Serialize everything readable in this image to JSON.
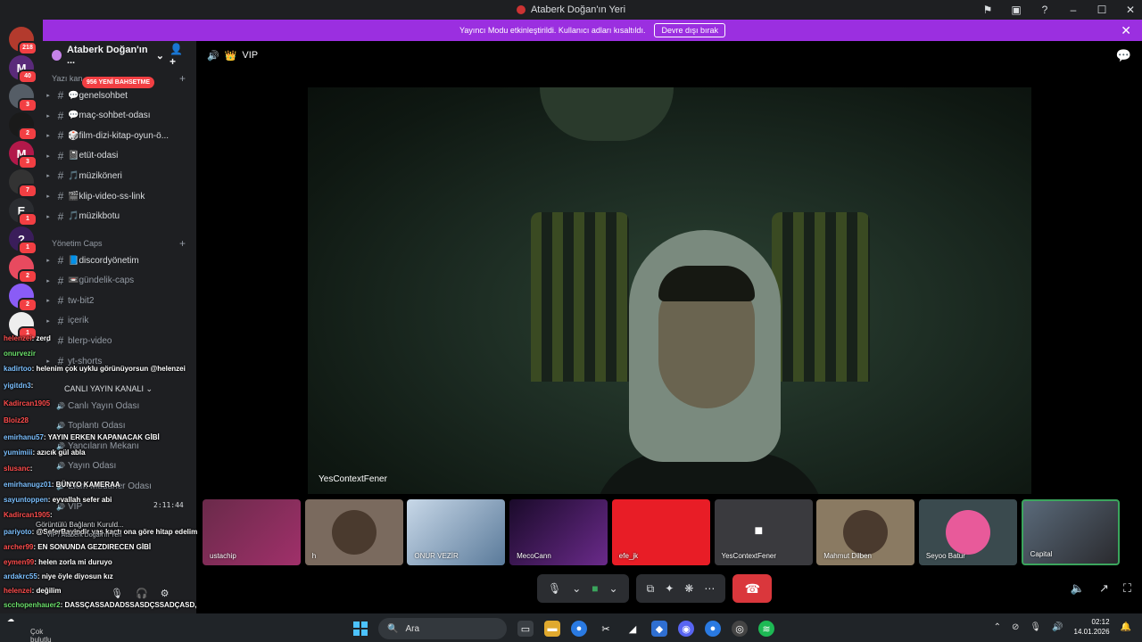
{
  "window": {
    "title": "Ataberk Doğan'ın Yeri"
  },
  "banner": {
    "text": "Yayıncı Modu etkinleştirildi. Kullanıcı adları kısaltıldı.",
    "button": "Devre dışı bırak"
  },
  "servers": [
    {
      "letter": "",
      "badge": "218",
      "color": "#b33a2d"
    },
    {
      "letter": "M",
      "badge": "40",
      "color": "#5a2a7a"
    },
    {
      "letter": "",
      "badge": "3",
      "color": "#555d66"
    },
    {
      "letter": "",
      "badge": "2",
      "color": "#1a1a1a"
    },
    {
      "letter": "M",
      "badge": "3",
      "color": "#b2194a"
    },
    {
      "letter": "",
      "badge": "7",
      "color": "#333"
    },
    {
      "letter": "E",
      "badge": "1",
      "color": "#2b2d31"
    },
    {
      "letter": "?",
      "badge": "1",
      "color": "#3a1d5a"
    },
    {
      "letter": "",
      "badge": "2",
      "color": "#e84a5f"
    },
    {
      "letter": "",
      "badge": "2",
      "color": "#8a5cf6"
    },
    {
      "letter": "",
      "badge": "1",
      "color": "#eee"
    }
  ],
  "sidebar": {
    "guild_name": "Ataberk Doğan'ın ...",
    "mention_badge": "956 YENİ BAHSETME",
    "category1": "Yazı kan",
    "category2": "Yönetim Caps",
    "category3": "CANLI YAYIN KANALI",
    "channels_text": [
      {
        "emoji": "💬",
        "name": "genelsohbet"
      },
      {
        "emoji": "💬",
        "name": "maç-sohbet-odası"
      },
      {
        "emoji": "🎲",
        "name": "film-dizi-kitap-oyun-ö..."
      },
      {
        "emoji": "📓",
        "name": "etüt-odasi"
      },
      {
        "emoji": "🎵",
        "name": "müziköneri"
      },
      {
        "emoji": "🎬",
        "name": "klip-video-ss-link"
      },
      {
        "emoji": "🎵",
        "name": "müzikbotu"
      }
    ],
    "channels_admin": [
      {
        "emoji": "📘",
        "name": "discordyönetim"
      },
      {
        "emoji": "📼",
        "name": "gündelik-caps"
      },
      {
        "emoji": "",
        "name": "tw-bit2"
      },
      {
        "emoji": "",
        "name": "içerik"
      },
      {
        "emoji": "",
        "name": "blerp-video"
      },
      {
        "emoji": "",
        "name": "yt-shorts"
      }
    ],
    "voice_channels": [
      "Canlı Yayın Odası",
      "Toplantı Odası",
      "Yancıların Mekanı",
      "Yayın Odası",
      "Ekim Müdürler Odası",
      "VIP"
    ]
  },
  "stage": {
    "channel": "VIP",
    "main_speaker": "YesContextFener",
    "tiles": [
      "ustachip",
      "h",
      "ONUR VEZİR",
      "MecoCann",
      "efe_jk",
      "YesContextFener",
      "Mahmut Dilben",
      "Seyoo Batur",
      "Capital"
    ]
  },
  "overlay": {
    "messages": [
      {
        "user": "helenzei",
        "text": ": zerd"
      },
      {
        "user": "onurvezir",
        "text": ""
      },
      {
        "user": "kadirtoo",
        "text": ": helenim çok uyklu görünüyorsun @helenzei"
      },
      {
        "user": "yigitdn3",
        "text": ":"
      },
      {
        "user": "Kadircan1905",
        "text": ""
      },
      {
        "user": "Bloiz28",
        "text": ""
      },
      {
        "user": "emirhanu57",
        "text": ": YAYIN ERKEN KAPANACAK GİBİ"
      },
      {
        "user": "yumimiii",
        "text": ": azıcık gül abla"
      },
      {
        "user": "slusanc",
        "text": ":"
      },
      {
        "user": "emirhanugz01",
        "text": ": BÜNYO KAMERAA"
      },
      {
        "user": "sayuntoppen",
        "text": ": eyvallah sefer abi"
      },
      {
        "user": "Kadircan1905",
        "text": ":"
      },
      {
        "user": "pariyoto",
        "text": ": @SeferBayindir yaş kaçtı ona göre hitap edelim"
      },
      {
        "user": "archer99",
        "text": ": EN SONUNDA GEZDIRECEN GİBİ"
      },
      {
        "user": "eymen99",
        "text": ": helen zorla mi duruyo"
      },
      {
        "user": "ardakrc55",
        "text": ": niye öyle diyosun kız"
      },
      {
        "user": "helenzei",
        "text": ": değilim"
      },
      {
        "user": "scchopenhauer2",
        "text": ": DASSÇASSADADSSASDÇSSADÇASD,"
      },
      {
        "user": "dertist15",
        "text": ": Bünyemin bekleniyor DC'ye."
      }
    ],
    "connection_status": "Görüntülü Bağlantı Kuruld...",
    "connection_sub": "VIP / Ataberk Doğan'ın Yeri",
    "timer": "2:11:44",
    "panel_user": "Capital"
  },
  "taskbar": {
    "weather": "Çok bulutlu",
    "search_placeholder": "Ara",
    "time": "02:12",
    "date": "14.01.2026"
  }
}
